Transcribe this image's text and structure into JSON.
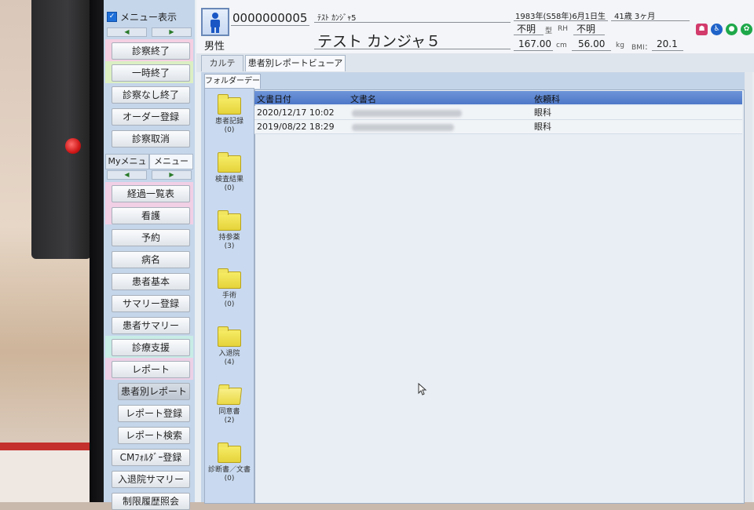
{
  "left_menu": {
    "toggle_label": "メニュー表示",
    "buttons_top": [
      "診察終了",
      "一時終了",
      "診察なし終了",
      "オーダー登録",
      "診察取消"
    ],
    "subtabs": [
      "Myメニュー",
      "メニュー"
    ],
    "items": [
      "経過一覧表",
      "看護",
      "予約",
      "病名",
      "患者基本",
      "サマリー登録",
      "患者サマリー",
      "診療支援",
      "レポート",
      "患者別レポート",
      "レポート登録",
      "レポート検索",
      "CMﾌｫﾙﾀﾞｰ登録",
      "入退院サマリー",
      "制限履歴照会"
    ]
  },
  "patient": {
    "id": "0000000005",
    "name_kana": "ﾃｽﾄ ｶﾝｼﾞｬ5",
    "name": "テスト カンジャ５",
    "sex": "男性",
    "birth": "1983年(S58年)6月1日生",
    "age": "41歳 3ヶ月",
    "blood_type": "不明",
    "blood_type_label": "型",
    "rh_label": "RH",
    "rh": "不明",
    "height": "167.00",
    "height_unit": "cm",
    "weight": "56.00",
    "weight_unit": "kg",
    "bmi_label": "BMI：",
    "bmi": "20.1"
  },
  "tabs": [
    "カルテ",
    "患者別レポートビューアー"
  ],
  "folder_panel": {
    "tab": "フォルダーデータ",
    "folders": [
      {
        "name": "患者記録",
        "count": "(0)"
      },
      {
        "name": "検査結果",
        "count": "(0)"
      },
      {
        "name": "持参薬",
        "count": "(3)"
      },
      {
        "name": "手術",
        "count": "(0)"
      },
      {
        "name": "入退院",
        "count": "(4)"
      },
      {
        "name": "同意書",
        "count": "(2)"
      },
      {
        "name": "診断書／文書",
        "count": "(0)"
      }
    ]
  },
  "doc_table": {
    "columns": [
      "文書日付",
      "文書名",
      "依頼科"
    ],
    "rows": [
      {
        "date": "2020/12/17 10:02",
        "dept": "眼科"
      },
      {
        "date": "2019/08/22 18:29",
        "dept": "眼科"
      }
    ]
  },
  "colors": {
    "accent": "#1f56d6",
    "header_row": "#4e78c8",
    "folder": "#e5d33a"
  },
  "icons": [
    "user-icon",
    "patient-status-icons",
    "mouse-cursor-icon"
  ]
}
